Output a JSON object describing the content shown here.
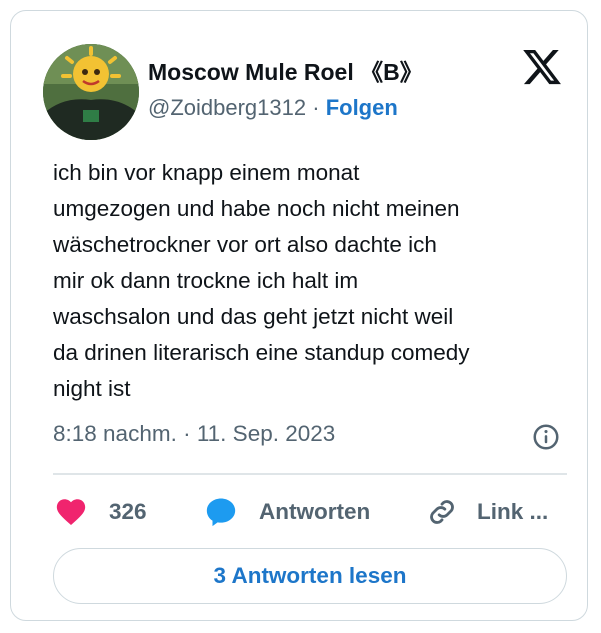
{
  "tweet": {
    "author_name": "Moscow Mule Roel 《B》",
    "handle": "@Zoidberg1312",
    "separator": "·",
    "follow_label": "Folgen",
    "text": "ich bin vor knapp einem monat\numgezogen und habe noch nicht meinen\nwäschetrockner vor ort also dachte ich\nmir ok dann trockne ich halt im\nwaschsalon und das geht jetzt nicht weil\nda drinen literarisch eine standup comedy\nnight ist",
    "timestamp": "8:18 nachm. · 11. Sep. 2023"
  },
  "actions": {
    "like_count": "326",
    "reply_label": "Antworten",
    "link_label": "Link ..."
  },
  "read_replies_label": "3 Antworten lesen",
  "icons": {
    "brand": "x-logo-icon",
    "info": "info-icon",
    "like": "heart-icon",
    "reply": "speech-bubble-icon",
    "link": "link-icon"
  },
  "colors": {
    "accent": "#1d76c9",
    "like": "#f0246e",
    "reply": "#1d9bf0",
    "muted": "#536471",
    "text": "#0f1419",
    "border": "#cfd9de"
  }
}
